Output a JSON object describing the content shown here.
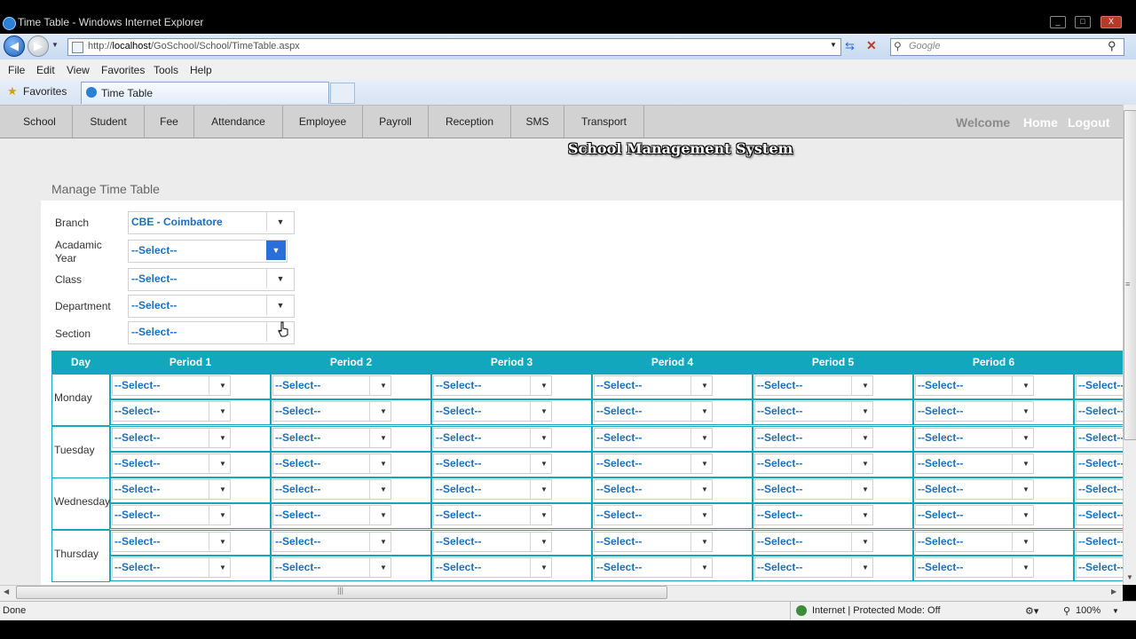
{
  "window": {
    "title": "Time Table - Windows Internet Explorer",
    "minimize": "_",
    "maximize": "□",
    "close": "X"
  },
  "address": {
    "url_prefix": "http://",
    "url_host": "localhost",
    "url_path": "/GoSchool/School/TimeTable.aspx",
    "search_placeholder": "Google"
  },
  "menu": [
    "File",
    "Edit",
    "View",
    "Favorites",
    "Tools",
    "Help"
  ],
  "favorites_label": "Favorites",
  "tab_title": "Time Table",
  "nav": {
    "items": [
      "School",
      "Student",
      "Fee",
      "Attendance",
      "Employee",
      "Payroll",
      "Reception",
      "SMS",
      "Transport"
    ],
    "welcome": "Welcome",
    "home": "Home",
    "logout": "Logout"
  },
  "system_name": "School Management System",
  "panel": {
    "title": "Manage Time Table",
    "fields": [
      {
        "label": "Branch",
        "value": "CBE - Coimbatore"
      },
      {
        "label": "Acadamic Year",
        "value": "--Select--"
      },
      {
        "label": "Class",
        "value": "--Select--"
      },
      {
        "label": "Department",
        "value": "--Select--"
      },
      {
        "label": "Section",
        "value": "--Select--"
      }
    ]
  },
  "grid": {
    "headers": [
      "Day",
      "Period 1",
      "Period 2",
      "Period 3",
      "Period 4",
      "Period 5",
      "Period 6"
    ],
    "days": [
      "Monday",
      "Tuesday",
      "Wednesday",
      "Thursday"
    ],
    "cell_value": "--Select--"
  },
  "status": {
    "left": "Done",
    "zone": "Internet | Protected Mode: Off",
    "zoom": "100%"
  },
  "colors": {
    "grid_header": "#12a7bd",
    "select_text": "#1c6fb8",
    "active_arrow": "#2a6fd9"
  }
}
